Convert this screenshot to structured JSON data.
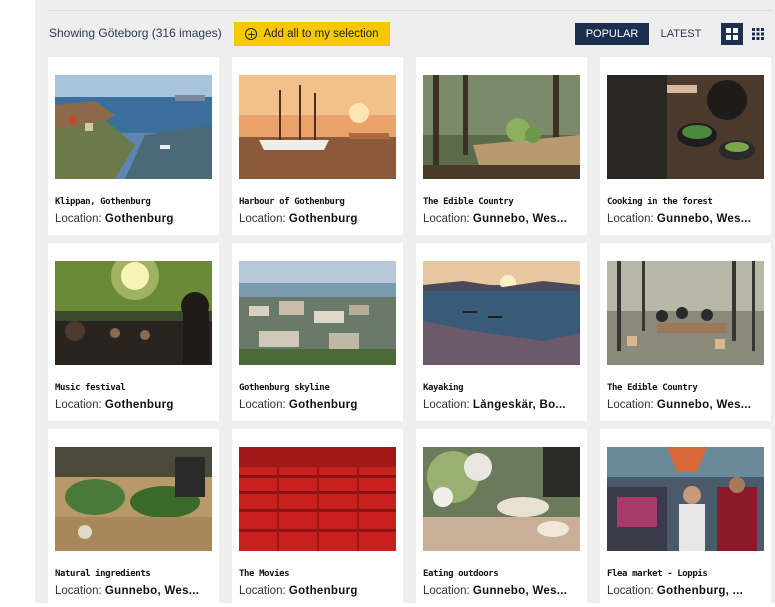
{
  "toolbar": {
    "showing_text": "Showing Göteborg (316 images)",
    "add_all_label": "Add all to my selection",
    "sort_popular": "POPULAR",
    "sort_latest": "LATEST",
    "active_sort": "POPULAR"
  },
  "location_prefix": "Location:",
  "colors": {
    "navy": "#1c2f4f",
    "yellow_button": "#f5c800",
    "panel_bg": "#eeeeee"
  },
  "icons": [
    "add-circle-icon",
    "grid-large-icon",
    "grid-small-icon"
  ],
  "images": [
    {
      "title": "Klippan, Gothenburg",
      "location": "Gothenburg"
    },
    {
      "title": "Harbour of Gothenburg",
      "location": "Gothenburg"
    },
    {
      "title": "The Edible Country",
      "location": "Gunnebo, Wes..."
    },
    {
      "title": "Cooking in the forest",
      "location": "Gunnebo, Wes..."
    },
    {
      "title": "Music festival",
      "location": "Gothenburg"
    },
    {
      "title": "Gothenburg skyline",
      "location": "Gothenburg"
    },
    {
      "title": "Kayaking",
      "location": "Långeskär, Bo..."
    },
    {
      "title": "The Edible Country",
      "location": "Gunnebo, Wes..."
    },
    {
      "title": "Natural ingredients",
      "location": "Gunnebo, Wes..."
    },
    {
      "title": "The Movies",
      "location": "Gothenburg"
    },
    {
      "title": "Eating outdoors",
      "location": "Gunnebo, Wes..."
    },
    {
      "title": "Flea market - Loppis",
      "location": "Gothenburg, ..."
    }
  ]
}
